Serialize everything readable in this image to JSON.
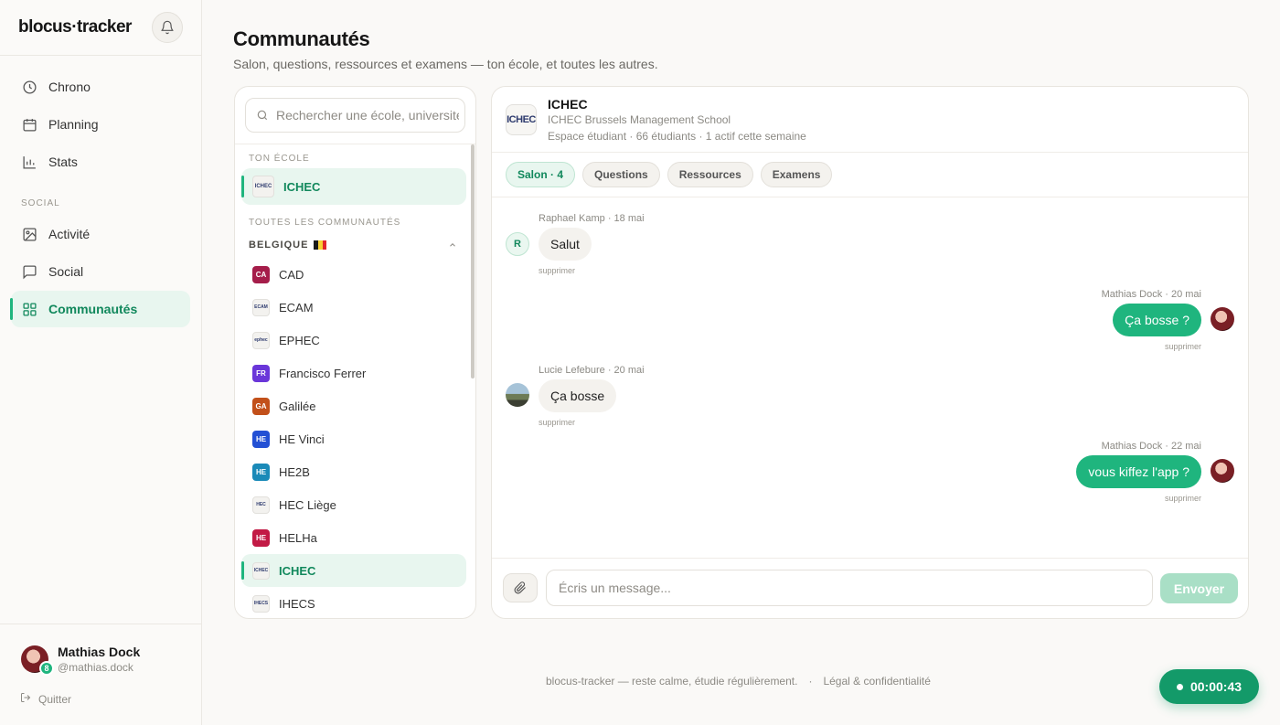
{
  "brand": "blocus·tracker",
  "nav": {
    "items": [
      {
        "label": "Chrono",
        "icon": "clock-icon"
      },
      {
        "label": "Planning",
        "icon": "calendar-icon"
      },
      {
        "label": "Stats",
        "icon": "bar-chart-icon"
      }
    ],
    "section_social": "SOCIAL",
    "social_items": [
      {
        "label": "Activité",
        "icon": "image-icon"
      },
      {
        "label": "Social",
        "icon": "chat-bubble-icon"
      },
      {
        "label": "Communautés",
        "icon": "grid-icon",
        "active": true
      }
    ]
  },
  "profile": {
    "name": "Mathias Dock",
    "handle": "@mathias.dock",
    "badge": "8",
    "quit_label": "Quitter"
  },
  "header": {
    "title": "Communautés",
    "subtitle": "Salon, questions, ressources et examens — ton école, et toutes les autres."
  },
  "communities": {
    "search_placeholder": "Rechercher une école, université…",
    "my_school_label": "TON ÉCOLE",
    "my_school": {
      "name": "ICHEC",
      "logo": "ICHEC"
    },
    "all_label": "TOUTES LES COMMUNAUTÉS",
    "country": "BELGIQUE",
    "schools": [
      {
        "name": "CAD",
        "abbr": "CA",
        "color": "#a51d4a",
        "type": "initials"
      },
      {
        "name": "ECAM",
        "abbr": "ECAM",
        "type": "logo"
      },
      {
        "name": "EPHEC",
        "abbr": "ephec",
        "type": "logo"
      },
      {
        "name": "Francisco Ferrer",
        "abbr": "FR",
        "color": "#6a36d9",
        "type": "initials"
      },
      {
        "name": "Galilée",
        "abbr": "GA",
        "color": "#c2501a",
        "type": "initials"
      },
      {
        "name": "HE Vinci",
        "abbr": "HE",
        "color": "#2350d4",
        "type": "initials"
      },
      {
        "name": "HE2B",
        "abbr": "HE",
        "color": "#1a8ab8",
        "type": "initials"
      },
      {
        "name": "HEC Liège",
        "abbr": "HEC",
        "type": "logo"
      },
      {
        "name": "HELHa",
        "abbr": "HE",
        "color": "#c21a45",
        "type": "initials"
      },
      {
        "name": "ICHEC",
        "abbr": "ICHEC",
        "type": "logo",
        "active": true
      },
      {
        "name": "IHECS",
        "abbr": "IHECS",
        "type": "logo"
      }
    ]
  },
  "chat": {
    "logo": "ICHEC",
    "name": "ICHEC",
    "full_name": "ICHEC Brussels Management School",
    "meta": "Espace étudiant · 66 étudiants · 1 actif cette semaine",
    "tabs": [
      {
        "label": "Salon · 4",
        "active": true
      },
      {
        "label": "Questions"
      },
      {
        "label": "Ressources"
      },
      {
        "label": "Examens"
      }
    ],
    "messages": [
      {
        "author_meta": "Raphael Kamp · 18 mai",
        "text": "Salut",
        "side": "in",
        "avatar": "R",
        "delete": "supprimer"
      },
      {
        "author_meta": "Mathias Dock · 20 mai",
        "text": "Ça bosse ?",
        "side": "out",
        "delete": "supprimer"
      },
      {
        "author_meta": "Lucie Lefebure · 20 mai",
        "text": "Ça bosse",
        "side": "in",
        "delete": "supprimer"
      },
      {
        "author_meta": "Mathias Dock · 22 mai",
        "text": "vous kiffez l'app ?",
        "side": "out",
        "delete": "supprimer"
      }
    ],
    "input_placeholder": "Écris un message...",
    "send_label": "Envoyer"
  },
  "footer": {
    "tagline": "blocus-tracker — reste calme, étudie régulièrement.",
    "separator": "·",
    "legal": "Légal & confidentialité"
  },
  "timer": "00:00:43",
  "colors": {
    "accent": "#1fb57e",
    "accent_dark": "#139a69",
    "accent_soft": "#e8f6ef"
  }
}
